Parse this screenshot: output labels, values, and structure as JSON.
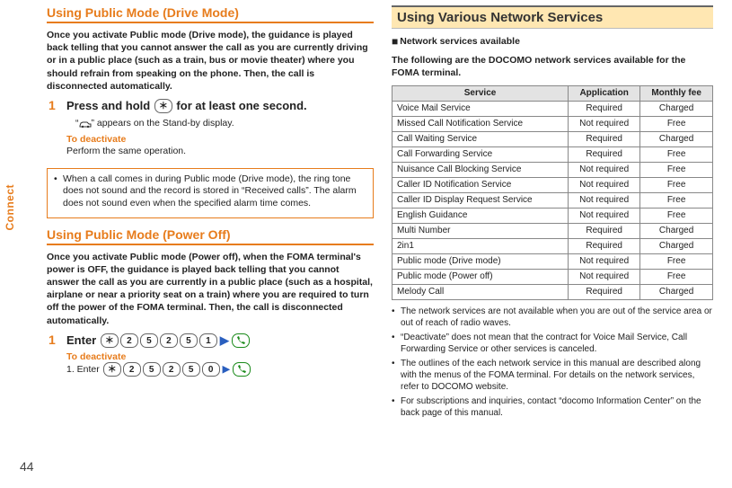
{
  "side_tab": "Connect",
  "page_number": "44",
  "left": {
    "drive": {
      "heading": "Using Public Mode (Drive Mode)",
      "intro": "Once you activate Public mode (Drive mode), the guidance is played back telling that you cannot answer the call as you are currently driving or in a public place (such as a train, bus or movie theater) where you should refrain from speaking on the phone. Then, the call is disconnected automatically.",
      "step_num": "1",
      "step_title_a": "Press and hold ",
      "step_key": "＊",
      "step_title_b": " for at least one second.",
      "standby_a": "“",
      "standby_b": "” appears on the Stand-by display.",
      "deact_label": "To deactivate",
      "deact_text": "Perform the same operation.",
      "note": "When a call comes in during Public mode (Drive mode), the ring tone does not sound and the record is stored in “Received calls”. The alarm does not sound even when the specified alarm time comes."
    },
    "poweroff": {
      "heading": "Using Public Mode (Power Off)",
      "intro": "Once you activate Public mode (Power off), when the FOMA terminal's power is OFF, the guidance is played back telling that you cannot answer the call as you are currently in a public place (such as a hospital, airplane or near a priority seat on a train) where you are required to turn off the power of the FOMA terminal. Then, the call is disconnected automatically.",
      "step_num": "1",
      "step_label": "Enter",
      "keys_on": [
        "＊",
        "2",
        "5",
        "2",
        "5",
        "1"
      ],
      "deact_label": "To deactivate",
      "deact_prefix": "1. Enter ",
      "keys_off": [
        "＊",
        "2",
        "5",
        "2",
        "5",
        "0"
      ]
    }
  },
  "right": {
    "heading": "Using Various Network Services",
    "sub_heading": "Network services available",
    "intro": "The following are the DOCOMO network services available for the FOMA terminal.",
    "col_service": "Service",
    "col_app": "Application",
    "col_fee": "Monthly fee",
    "rows": [
      {
        "s": "Voice Mail Service",
        "a": "Required",
        "f": "Charged"
      },
      {
        "s": "Missed Call Notification Service",
        "a": "Not required",
        "f": "Free"
      },
      {
        "s": "Call Waiting Service",
        "a": "Required",
        "f": "Charged"
      },
      {
        "s": "Call Forwarding Service",
        "a": "Required",
        "f": "Free"
      },
      {
        "s": "Nuisance Call Blocking Service",
        "a": "Not required",
        "f": "Free"
      },
      {
        "s": "Caller ID Notification Service",
        "a": "Not required",
        "f": "Free"
      },
      {
        "s": "Caller ID Display Request Service",
        "a": "Not required",
        "f": "Free"
      },
      {
        "s": "English Guidance",
        "a": "Not required",
        "f": "Free"
      },
      {
        "s": "Multi Number",
        "a": "Required",
        "f": "Charged"
      },
      {
        "s": "2in1",
        "a": "Required",
        "f": "Charged"
      },
      {
        "s": "Public mode (Drive mode)",
        "a": "Not required",
        "f": "Free"
      },
      {
        "s": "Public mode (Power off)",
        "a": "Not required",
        "f": "Free"
      },
      {
        "s": "Melody Call",
        "a": "Required",
        "f": "Charged"
      }
    ],
    "notes": [
      "The network services are not available when you are out of the service area or out of reach of radio waves.",
      "“Deactivate” does not mean that the contract for Voice Mail Service, Call Forwarding Service or other services is canceled.",
      "The outlines of the each network service in this manual are described along with the menus of the FOMA terminal. For details on the network services, refer to DOCOMO website.",
      "For subscriptions and inquiries, contact “docomo Information Center” on the back page of this manual."
    ]
  }
}
